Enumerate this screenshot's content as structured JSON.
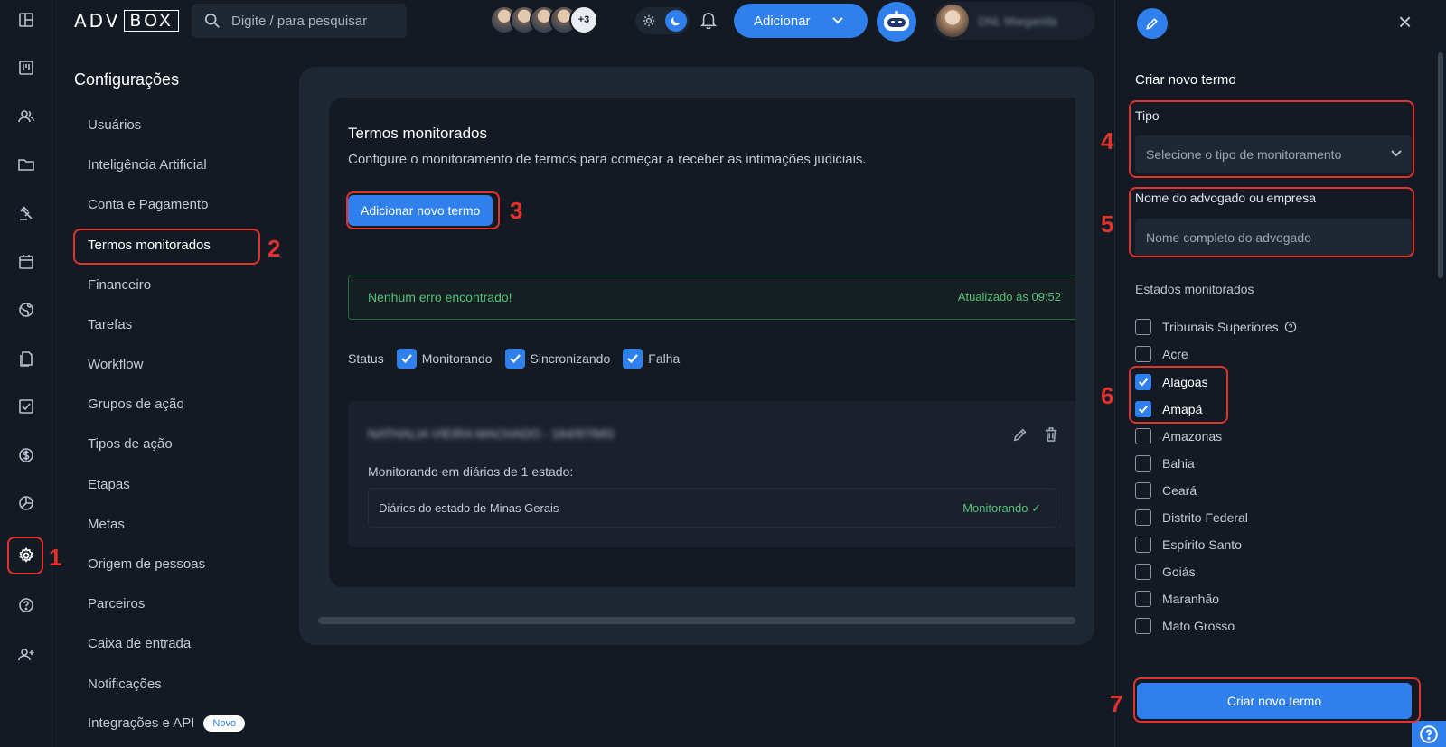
{
  "brand": {
    "logo_left": "ADV",
    "logo_right": "BOX"
  },
  "search": {
    "placeholder": "Digite / para pesquisar"
  },
  "header": {
    "avatars_more": "+3",
    "add_label": "Adicionar",
    "user_name": "DNL Margarida"
  },
  "settings_nav": {
    "title": "Configurações",
    "items": [
      {
        "label": "Usuários"
      },
      {
        "label": "Inteligência Artificial"
      },
      {
        "label": "Conta e Pagamento"
      },
      {
        "label": "Termos monitorados"
      },
      {
        "label": "Financeiro"
      },
      {
        "label": "Tarefas"
      },
      {
        "label": "Workflow"
      },
      {
        "label": "Grupos de ação"
      },
      {
        "label": "Tipos de ação"
      },
      {
        "label": "Etapas"
      },
      {
        "label": "Metas"
      },
      {
        "label": "Origem de pessoas"
      },
      {
        "label": "Parceiros"
      },
      {
        "label": "Caixa de entrada"
      },
      {
        "label": "Notificações"
      },
      {
        "label": "Integrações e API"
      }
    ],
    "active_item": "Termos monitorados",
    "new_badge": "Novo"
  },
  "main": {
    "title": "Termos monitorados",
    "subtitle": "Configure o monitoramento de termos para começar a receber as intimações judiciais.",
    "add_button": "Adicionar novo termo",
    "status_ok": "Nenhum erro encontrado!",
    "updated_at": "Atualizado às 09:52",
    "status_label": "Status",
    "filters": [
      {
        "label": "Monitorando",
        "checked": true
      },
      {
        "label": "Sincronizando",
        "checked": true
      },
      {
        "label": "Falha",
        "checked": true
      }
    ],
    "term": {
      "name": "NATHALIA VIEIRA MACHADO - 164/97/MG",
      "monitoring_text": "Monitorando em diários de 1 estado:",
      "row_label": "Diários do estado de Minas Gerais",
      "row_status": "Monitorando"
    }
  },
  "panel": {
    "title": "Criar novo termo",
    "tipo_label": "Tipo",
    "tipo_placeholder": "Selecione o tipo de monitoramento",
    "name_label": "Nome do advogado ou empresa",
    "name_placeholder": "Nome completo do advogado",
    "states_label": "Estados monitorados",
    "states": [
      {
        "label": "Tribunais Superiores",
        "checked": false,
        "help": true
      },
      {
        "label": "Acre",
        "checked": false
      },
      {
        "label": "Alagoas",
        "checked": true
      },
      {
        "label": "Amapá",
        "checked": true
      },
      {
        "label": "Amazonas",
        "checked": false
      },
      {
        "label": "Bahia",
        "checked": false
      },
      {
        "label": "Ceará",
        "checked": false
      },
      {
        "label": "Distrito Federal",
        "checked": false
      },
      {
        "label": "Espírito Santo",
        "checked": false
      },
      {
        "label": "Goiás",
        "checked": false
      },
      {
        "label": "Maranhão",
        "checked": false
      },
      {
        "label": "Mato Grosso",
        "checked": false
      }
    ],
    "create_button": "Criar novo termo"
  },
  "annotations": [
    "1",
    "2",
    "3",
    "4",
    "5",
    "6",
    "7"
  ],
  "colors": {
    "accent": "#2f80ed",
    "success": "#52c27a",
    "annotation": "#e0332b"
  }
}
